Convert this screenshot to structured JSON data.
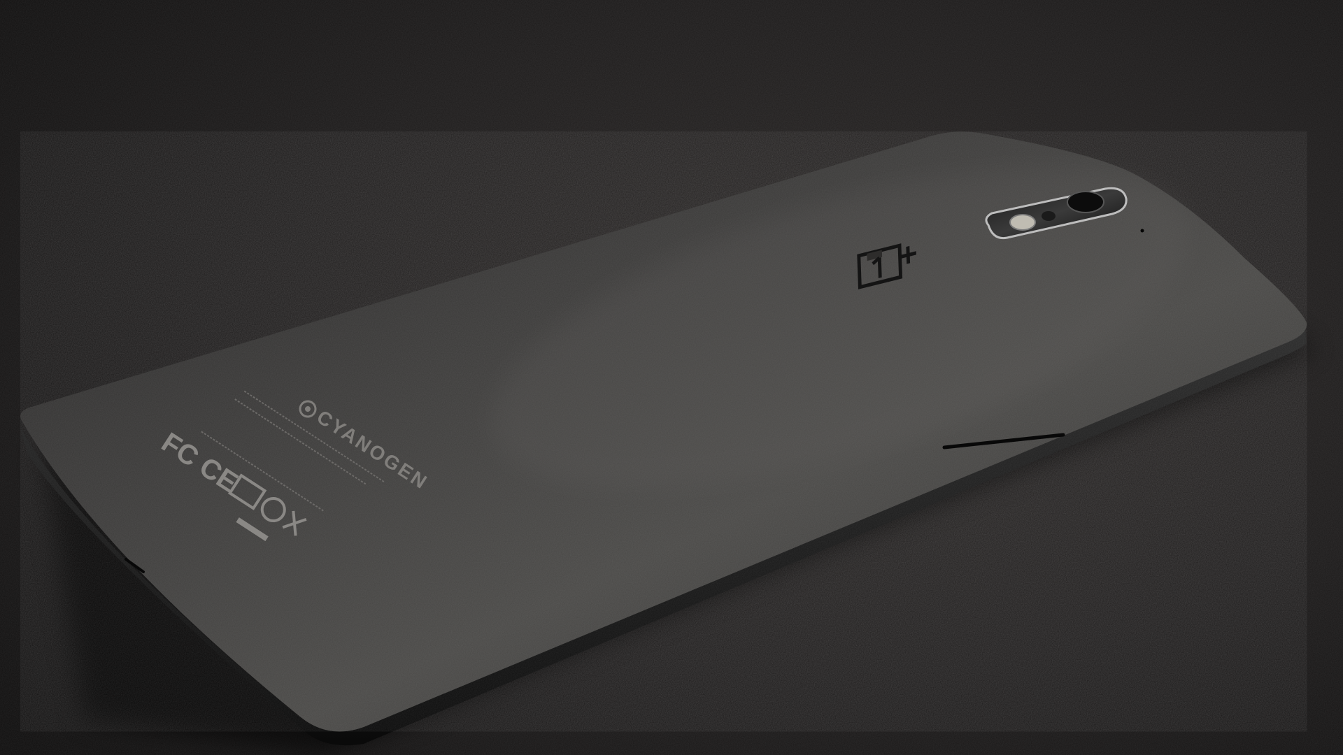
{
  "scene": {
    "subject": "phone",
    "background": "textured-surface"
  },
  "phone": {
    "brand_logo_text": "1+",
    "os_brand_text": "CYANOGEN",
    "regulatory_marks": "FC CE"
  },
  "colors": {
    "surface": "#141313",
    "surface_highlight": "#2a2726",
    "phone_body": "#2b2a29",
    "phone_highlight": "#4a4947",
    "phone_edge": "#0f0f0f",
    "logo": "#161616",
    "engraving": "#7a7876",
    "camera_ring": "#c8c8c8"
  },
  "icons": {
    "brand": "oneplus-logo-icon",
    "os": "cyanogen-logo-icon",
    "camera": "camera-lens-icon",
    "flash": "flash-icon",
    "certification": "regulatory-marks-icon"
  }
}
